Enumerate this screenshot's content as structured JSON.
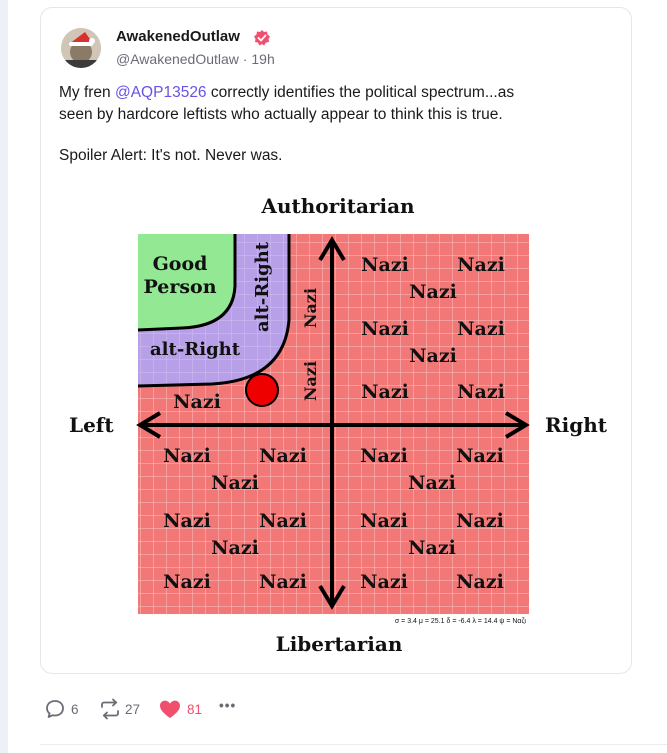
{
  "post": {
    "author_name": "AwakenedOutlaw",
    "handle": "@AwakenedOutlaw",
    "time_separator": " · ",
    "time": "19h",
    "body_line1_prefix": "My fren ",
    "body_mention": "@AQP13526",
    "body_line1_suffix": " correctly identifies the political spectrum...as",
    "body_line2": "seen by hardcore leftists who actually appear to think this is true.",
    "body_line3": "Spoiler Alert: It's not. Never was."
  },
  "meme": {
    "top_label": "Authoritarian",
    "bottom_label": "Libertarian",
    "left_label": "Left",
    "right_label": "Right",
    "good_person_line1": "Good",
    "good_person_line2": "Person",
    "alt_right_vertical": "alt-Right",
    "alt_right_horizontal": "alt-Right",
    "nazi": "Nazi",
    "stats": "σ = 3.4   μ = 25.1   δ = -6.4   λ = 14.4   ψ = Nαζι",
    "colors": {
      "grid_fill": "#f27878",
      "good_person": "#93e893",
      "alt_right": "#b7a0e8",
      "dot": "#ee0000"
    }
  },
  "actions": {
    "replies": "6",
    "reposts": "27",
    "likes": "81",
    "more": "•••"
  },
  "colors": {
    "accent": "#6552e8",
    "like": "#f0506e",
    "muted": "#6b6b76"
  }
}
